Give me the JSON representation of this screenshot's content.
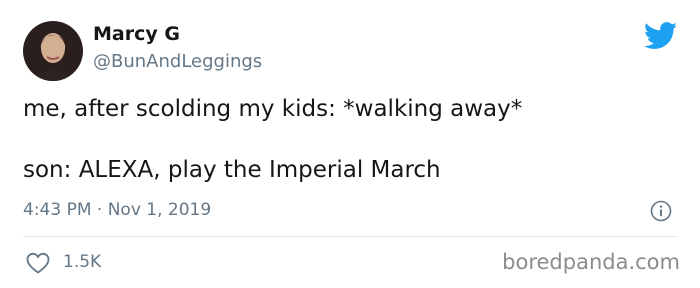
{
  "author": {
    "name": "Marcy G",
    "handle": "@BunAndLeggings"
  },
  "tweet": {
    "line1": "me, after scolding my kids: *walking away*",
    "line2": "son: ALEXA, play the Imperial March"
  },
  "meta": {
    "timestamp": "4:43 PM · Nov 1, 2019"
  },
  "engagement": {
    "likes": "1.5K"
  },
  "watermark": "boredpanda.com",
  "colors": {
    "brand": "#1da1f2",
    "muted": "#657786",
    "text": "#14171a"
  },
  "icons": [
    "twitter-bird-icon",
    "info-icon",
    "heart-icon"
  ]
}
